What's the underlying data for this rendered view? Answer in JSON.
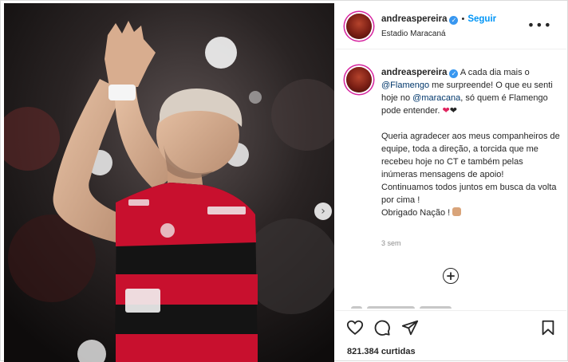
{
  "post": {
    "username": "andreaspereira",
    "verified_mark": "✓",
    "separator": "•",
    "follow_label": "Seguir",
    "location": "Estadio Maracaná",
    "more_label": "•••",
    "caption": {
      "lead": " A cada dia mais o ",
      "mention_1": "@Flamengo",
      "text_2": " me surpreende! O que eu senti hoje no ",
      "mention_2": "@maracana",
      "text_3": ", só quem é Flamengo pode entender. ",
      "heart_red": "❤",
      "heart_black": "❤",
      "para_2": "Queria agradecer aos meus companheiros de equipe, toda a direção, a torcida que me recebeu hoje no CT e também pelas inúmeras mensagens de apoio!",
      "para_3": "Continuamos todos juntos em busca da volta por cima !",
      "para_4": "Obrigado Nação ! "
    },
    "time_ago": "3 sem",
    "load_more": "+",
    "likes": "821.384 curtidas",
    "next_arrow": "›"
  },
  "colors": {
    "accent": "#0095f6",
    "verified": "#3897f0",
    "mention": "#00376b",
    "jersey_red": "#c8102e",
    "jersey_black": "#141414"
  },
  "icons": {
    "like": "heart-outline-icon",
    "comment": "comment-bubble-icon",
    "share": "paper-plane-icon",
    "save": "bookmark-icon",
    "carousel_next": "chevron-right-icon",
    "load_more": "plus-circle-icon",
    "options": "more-options-icon"
  }
}
